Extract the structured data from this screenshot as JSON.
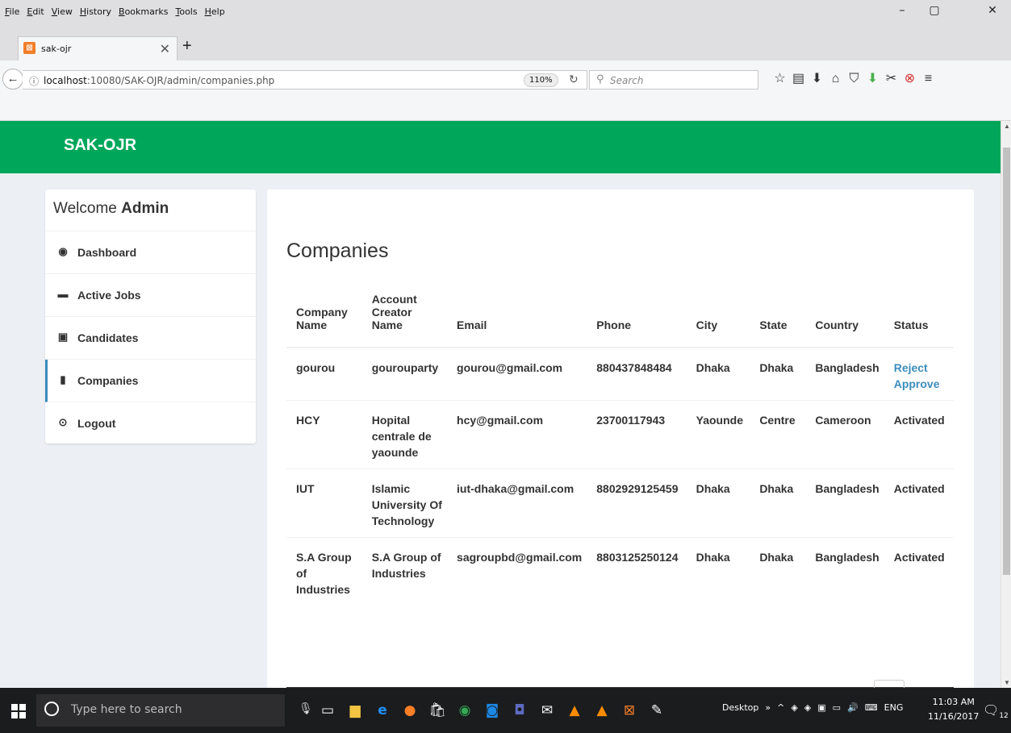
{
  "browser": {
    "menu": [
      "File",
      "Edit",
      "View",
      "History",
      "Bookmarks",
      "Tools",
      "Help"
    ],
    "tab_title": "sak-ojr",
    "url_host": "localhost",
    "url_path": ":10080/SAK-OJR/admin/companies.php",
    "zoom": "110%",
    "search_placeholder": "Search",
    "window_controls": [
      "–",
      "▢",
      "✕"
    ]
  },
  "app": {
    "brand": "SAK-OJR",
    "colors": {
      "header": "#00a65a",
      "link": "#3c8dbc",
      "background": "#ecf0f5"
    }
  },
  "sidebar": {
    "welcome_prefix": "Welcome",
    "welcome_user": "Admin",
    "items": [
      {
        "label": "Dashboard",
        "icon": "dashboard-icon"
      },
      {
        "label": "Active Jobs",
        "icon": "briefcase-icon"
      },
      {
        "label": "Candidates",
        "icon": "id-card-icon"
      },
      {
        "label": "Companies",
        "icon": "building-icon",
        "active": true
      },
      {
        "label": "Logout",
        "icon": "logout-icon"
      }
    ]
  },
  "main": {
    "title": "Companies",
    "columns": [
      "Company Name",
      "Account Creator Name",
      "Email",
      "Phone",
      "City",
      "State",
      "Country",
      "Status"
    ],
    "rows": [
      {
        "company": "gourou",
        "creator": "gourouparty",
        "email": "gourou@gmail.com",
        "phone": "880437848484",
        "city": "Dhaka",
        "state": "Dhaka",
        "country": "Bangladesh",
        "status": "",
        "actions": [
          "Reject",
          "Approve"
        ]
      },
      {
        "company": "HCY",
        "creator": "Hopital centrale de yaounde",
        "email": "hcy@gmail.com",
        "phone": "23700117943",
        "city": "Yaounde",
        "state": "Centre",
        "country": "Cameroon",
        "status": "Activated"
      },
      {
        "company": "IUT",
        "creator": "Islamic University Of Technology",
        "email": "iut-dhaka@gmail.com",
        "phone": "8802929125459",
        "city": "Dhaka",
        "state": "Dhaka",
        "country": "Bangladesh",
        "status": "Activated"
      },
      {
        "company": "S.A Group of Industries",
        "creator": "S.A Group of Industries",
        "email": "sagroupbd@gmail.com",
        "phone": "8803125250124",
        "city": "Dhaka",
        "state": "Dhaka",
        "country": "Bangladesh",
        "status": "Activated"
      }
    ]
  },
  "taskbar": {
    "search_placeholder": "Type here to search",
    "desktop_label": "Desktop",
    "language": "ENG",
    "time": "11:03 AM",
    "date": "11/16/2017",
    "notification_count": "12"
  }
}
